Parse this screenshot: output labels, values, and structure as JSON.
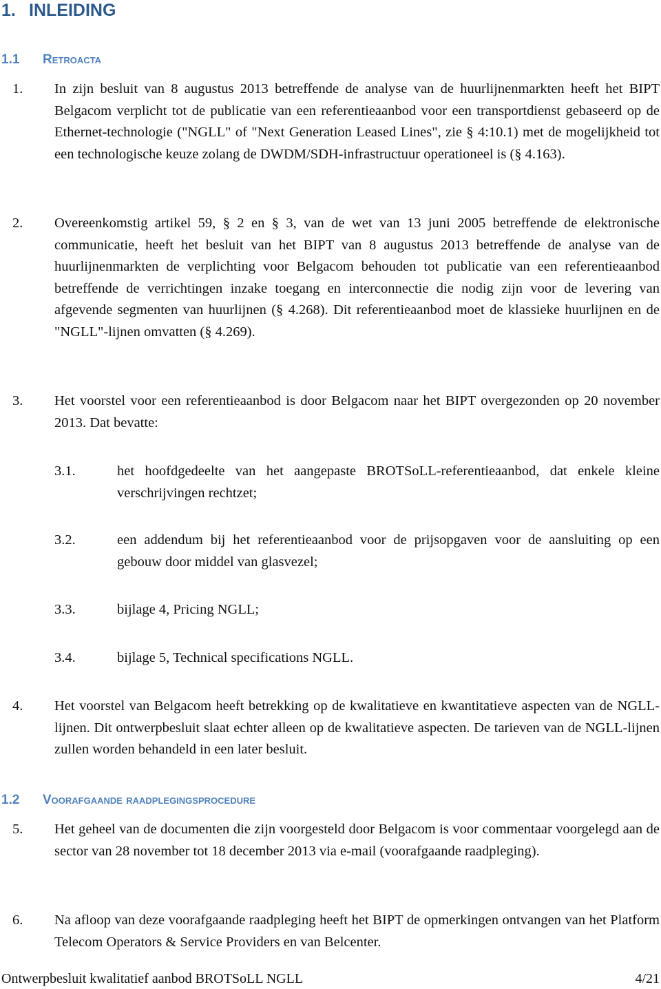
{
  "heading1": {
    "number": "1.",
    "title": "INLEIDING"
  },
  "section_1_1": {
    "number": "1.1",
    "title": "Retroacta"
  },
  "paragraphs": [
    {
      "number": "1.",
      "text": "In zijn besluit van 8 augustus 2013 betreffende de analyse van de huurlijnenmarkten heeft het BIPT Belgacom verplicht tot de publicatie van een referentieaanbod voor een transportdienst gebaseerd op de Ethernet-technologie (\"NGLL\" of \"Next Generation Leased Lines\", zie § 4:10.1) met de mogelijkheid tot een technologische keuze zolang de DWDM/SDH-infrastructuur operationeel is (§ 4.163)."
    },
    {
      "number": "2.",
      "text": "Overeenkomstig artikel 59, § 2 en § 3, van de wet van 13 juni 2005 betreffende de elektronische communicatie, heeft het besluit van het BIPT van 8 augustus 2013 betreffende de analyse van de huurlijnenmarkten de verplichting voor Belgacom behouden tot publicatie van een referentieaanbod betreffende de verrichtingen inzake toegang en interconnectie die nodig zijn voor de levering van afgevende segmenten van huurlijnen (§ 4.268). Dit referentieaanbod moet de klassieke huurlijnen en de \"NGLL\"-lijnen omvatten (§ 4.269)."
    },
    {
      "number": "3.",
      "text": "Het voorstel voor een referentieaanbod is door Belgacom naar het BIPT overgezonden op 20 november 2013. Dat bevatte:"
    },
    {
      "number": "4.",
      "text": "Het voorstel van Belgacom heeft betrekking op de kwalitatieve en kwantitatieve aspecten van de NGLL-lijnen. Dit ontwerpbesluit slaat echter alleen op de kwalitatieve aspecten. De tarieven van de NGLL-lijnen zullen worden behandeld in een later besluit."
    },
    {
      "number": "5.",
      "text": "Het geheel van de documenten die zijn voorgesteld door Belgacom is voor commentaar voorgelegd aan de sector van 28 november tot 18 december 2013 via e-mail (voorafgaande raadpleging)."
    },
    {
      "number": "6.",
      "text": "Na afloop van deze voorafgaande raadpleging heeft het BIPT de opmerkingen ontvangen van het Platform Telecom Operators & Service Providers en van Belcenter."
    }
  ],
  "subitems": [
    {
      "number": "3.1.",
      "text": "het hoofdgedeelte van het aangepaste BROTSoLL-referentieaanbod, dat enkele kleine verschrijvingen rechtzet;"
    },
    {
      "number": "3.2.",
      "text": "een addendum bij het referentieaanbod voor de prijsopgaven voor de aansluiting op een gebouw door middel van glasvezel;"
    },
    {
      "number": "3.3.",
      "text": "bijlage 4, Pricing NGLL;"
    },
    {
      "number": "3.4.",
      "text": "bijlage 5, Technical specifications NGLL."
    }
  ],
  "section_1_2": {
    "number": "1.2",
    "title": "Voorafgaande raadplegingsprocedure"
  },
  "footer": {
    "title": "Ontwerpbesluit kwalitatief aanbod BROTSoLL NGLL",
    "page": "4/21"
  }
}
